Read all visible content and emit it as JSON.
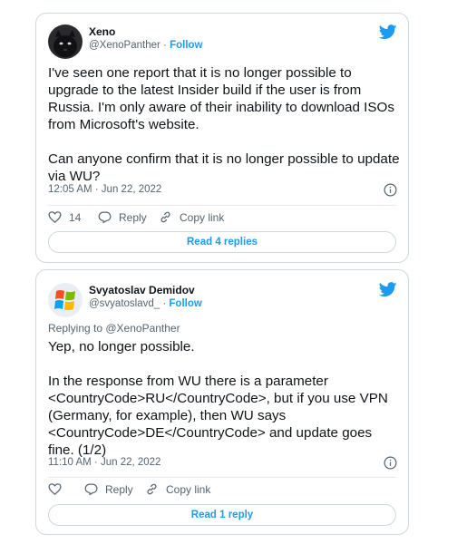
{
  "tweets": [
    {
      "author_name": "Xeno",
      "handle": "@XenoPanther",
      "separator": "·",
      "follow_label": "Follow",
      "replying_to": "",
      "text": "I've seen one report that it is no longer possible to upgrade to the latest Insider build if the user is from Russia. I'm only aware of their inability to download ISOs from Microsoft's website.\n\nCan anyone confirm that it is no longer possible to update via WU?",
      "timestamp": "12:05 AM · Jun 22, 2022",
      "like_count": "14",
      "reply_label": "Reply",
      "copy_link_label": "Copy link",
      "read_replies_label": "Read 4 replies",
      "avatar_icon": "black-panther-avatar"
    },
    {
      "author_name": "Svyatoslav Demidov",
      "handle": "@svyatoslavd_",
      "separator": "·",
      "follow_label": "Follow",
      "replying_to": "Replying to @XenoPanther",
      "text": "Yep, no longer possible.\n\nIn the response from WU there is a parameter <CountryCode>RU</CountryCode>, but if you use VPN (Germany, for example), then WU says <CountryCode>DE</CountryCode> and update goes fine. (1/2)",
      "timestamp": "11:10 AM · Jun 22, 2022",
      "like_count": "",
      "reply_label": "Reply",
      "copy_link_label": "Copy link",
      "read_replies_label": "Read 1 reply",
      "avatar_icon": "windows-xp-logo-avatar"
    }
  ],
  "colors": {
    "accent": "#1d9bf0",
    "text": "#0f1419",
    "muted": "#536471",
    "border": "#cfd9de"
  },
  "icons": [
    "twitter-bird-icon",
    "info-icon",
    "heart-icon",
    "reply-icon",
    "link-icon"
  ]
}
